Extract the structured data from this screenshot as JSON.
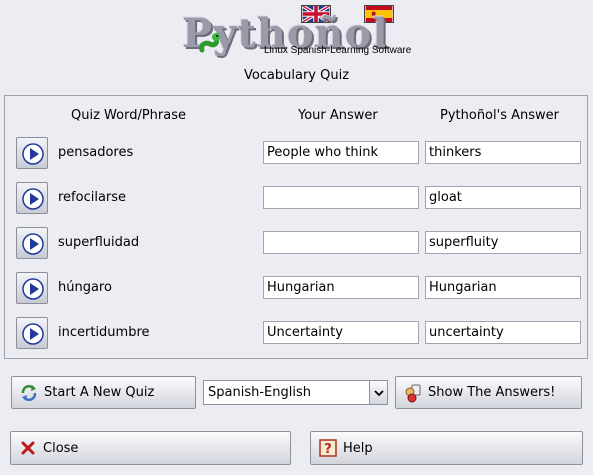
{
  "header": {
    "logo_text": "Pythoñol",
    "logo_subtitle": "Linux Spanish-Learning Software",
    "subtitle": "Vocabulary Quiz",
    "flag_left": "uk-flag-icon",
    "flag_right": "spain-flag-icon"
  },
  "columns": {
    "word": "Quiz Word/Phrase",
    "answer": "Your Answer",
    "solution": "Pythoñol's Answer"
  },
  "rows": [
    {
      "word": "pensadores",
      "answer": "People who think",
      "solution": "thinkers"
    },
    {
      "word": "refocilarse",
      "answer": "",
      "solution": "gloat"
    },
    {
      "word": "superfluidad",
      "answer": "",
      "solution": "superfluity"
    },
    {
      "word": "húngaro",
      "answer": "Hungarian",
      "solution": "Hungarian"
    },
    {
      "word": "incertidumbre",
      "answer": "Uncertainty",
      "solution": "uncertainty"
    }
  ],
  "controls": {
    "new_quiz_label": "Start A New Quiz",
    "direction_value": "Spanish-English",
    "show_answers_label": "Show The Answers!",
    "close_label": "Close",
    "help_label": "Help"
  },
  "icons": {
    "play": "play-icon",
    "new_quiz": "refresh-icon",
    "show_answers": "answers-icon",
    "close": "close-icon",
    "help": "help-icon",
    "dropdown": "chevron-down-icon"
  },
  "colors": {
    "background": "#ecedf2",
    "play_arrow": "#1f3a9a"
  }
}
